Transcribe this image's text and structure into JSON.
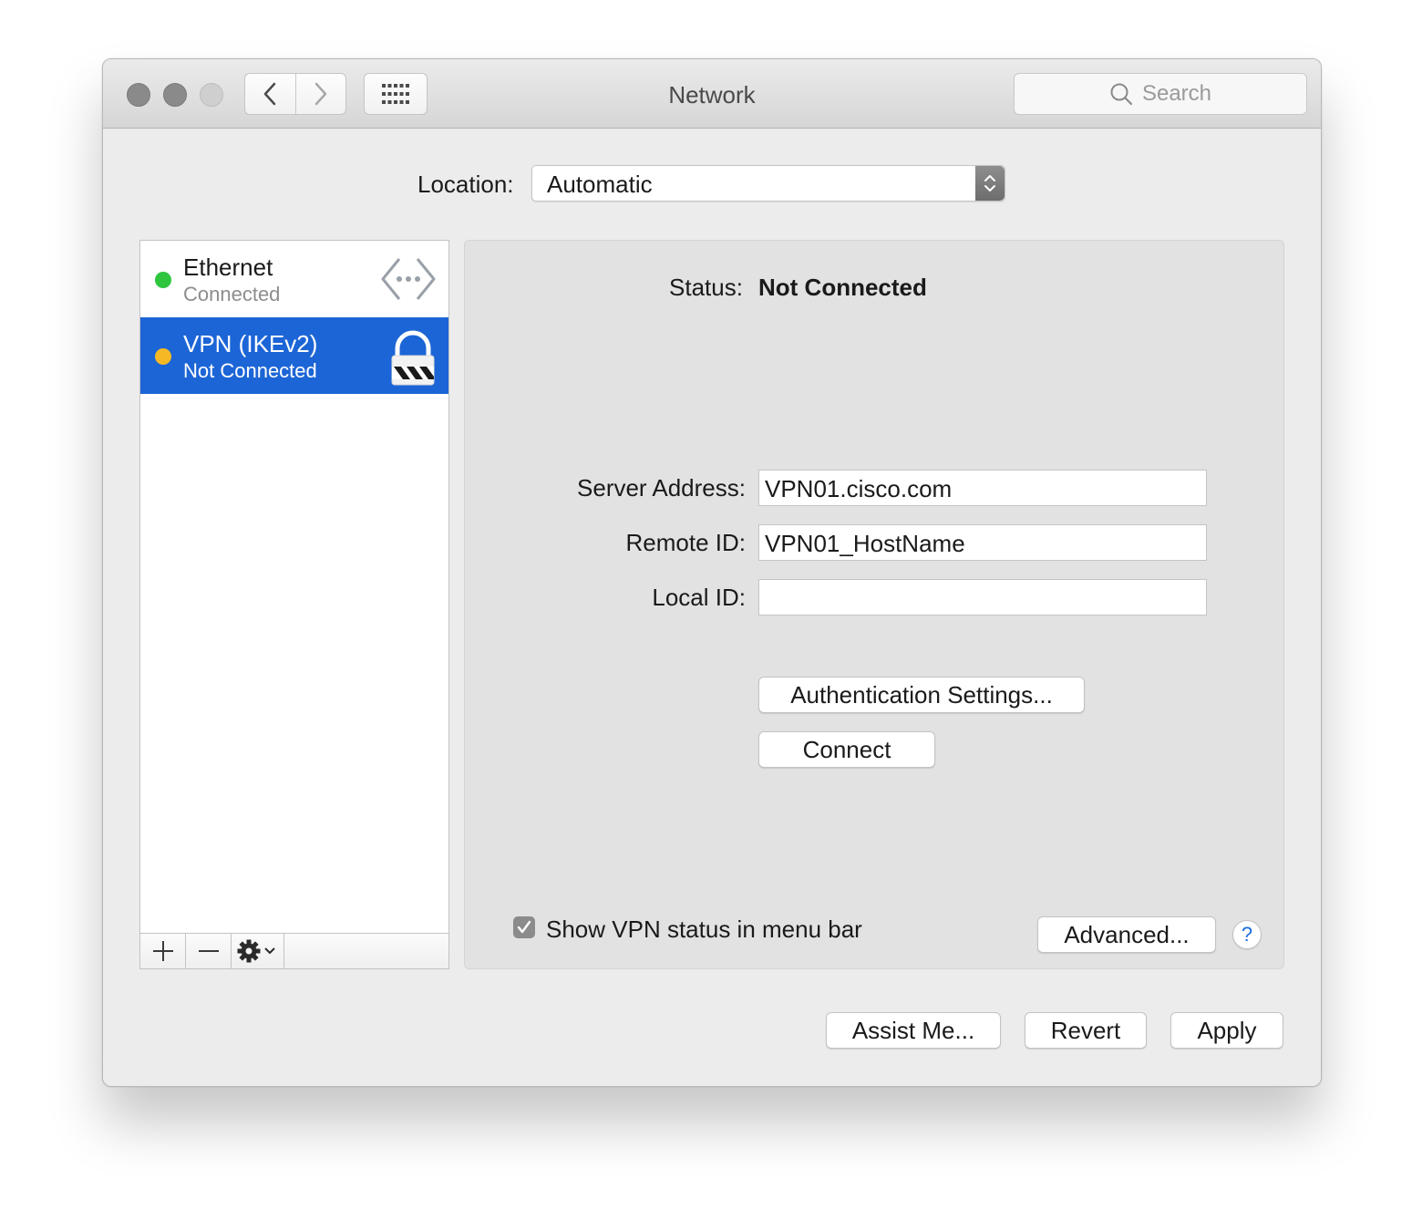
{
  "window": {
    "title": "Network"
  },
  "toolbar": {
    "back_icon": "chevron-left-icon",
    "forward_icon": "chevron-right-icon",
    "grid_icon": "grid-icon",
    "search_placeholder": "Search"
  },
  "location": {
    "label": "Location:",
    "value": "Automatic"
  },
  "services": [
    {
      "name": "Ethernet",
      "status": "Connected",
      "status_color": "#2fc53f",
      "icon": "ethernet-arrows-icon",
      "selected": false
    },
    {
      "name": "VPN (IKEv2)",
      "status": "Not Connected",
      "status_color": "#f6b925",
      "icon": "vpn-lock-icon",
      "selected": true
    }
  ],
  "list_controls": {
    "add": "+",
    "remove": "—",
    "action_icon": "gear-icon"
  },
  "detail": {
    "status_label": "Status:",
    "status_value": "Not Connected",
    "server_address_label": "Server Address:",
    "server_address_value": "VPN01.cisco.com",
    "remote_id_label": "Remote ID:",
    "remote_id_value": "VPN01_HostName",
    "local_id_label": "Local ID:",
    "local_id_value": "",
    "auth_button": "Authentication Settings...",
    "connect_button": "Connect",
    "show_status_label": "Show VPN status in menu bar",
    "show_status_checked": true,
    "advanced_button": "Advanced...",
    "help_label": "?"
  },
  "footer": {
    "assist": "Assist Me...",
    "revert": "Revert",
    "apply": "Apply"
  },
  "colors": {
    "selection": "#1c65d6",
    "accent": "#1a6ddb"
  }
}
